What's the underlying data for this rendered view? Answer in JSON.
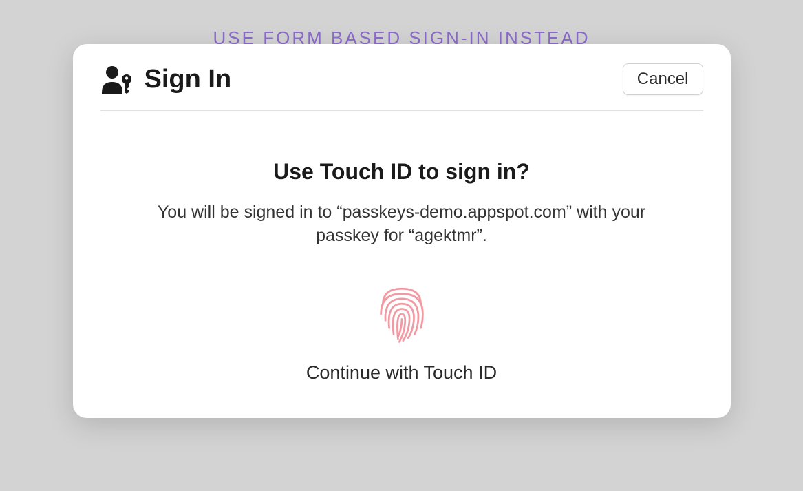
{
  "background": {
    "link_text": "USE FORM BASED SIGN-IN INSTEAD"
  },
  "dialog": {
    "title": "Sign In",
    "cancel_label": "Cancel",
    "prompt_heading": "Use Touch ID to sign in?",
    "prompt_description": "You will be signed in to “passkeys-demo.appspot.com” with your passkey for “agektmr”.",
    "continue_label": "Continue with Touch ID"
  },
  "colors": {
    "link": "#8b6bcc",
    "fingerprint": "#f29aa3"
  }
}
